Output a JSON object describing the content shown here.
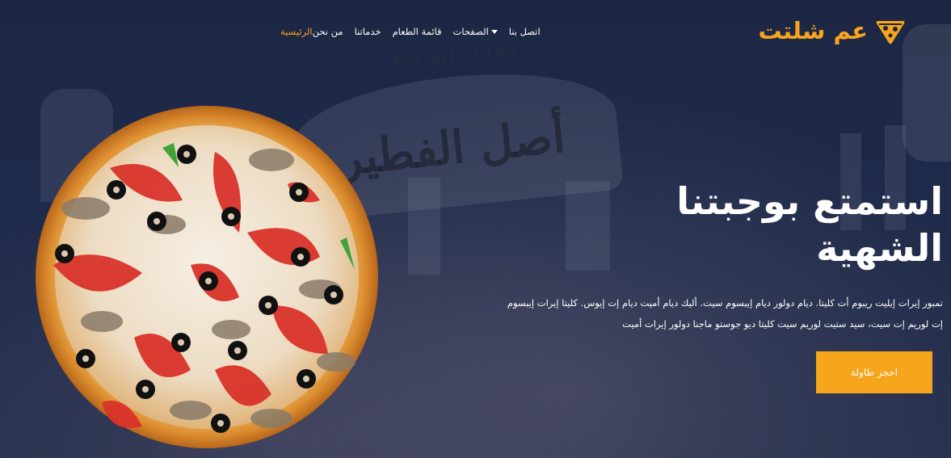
{
  "brand": {
    "name": "عم شلتت",
    "color": "#f7a51c",
    "icon": "pizza-slice-icon"
  },
  "nav": {
    "items": [
      {
        "label": "الرئيسية",
        "active": true
      },
      {
        "label": "من نحن"
      },
      {
        "label": "خدماتنا"
      },
      {
        "label": "قائمة الطعام"
      },
      {
        "label": "الصفحات",
        "dropdown": true
      },
      {
        "label": "اتصل بنا"
      }
    ]
  },
  "hero": {
    "title_line1": "استمتع بوجبتنا",
    "title_line2": "الشهية",
    "description": "تمبور إيرات إيليت ريبوم أت كليتا. ديام دولور ديام إيبسوم سيت. أليك ديام أميت ديام إت إيوس. كليتا إيرات إيبسوم إت لوريم إت سيت، سيد ستيت لوريم سيت كليتا ديو جوستو ماجنا دولور إيرات أميت",
    "cta_label": "احجز طاولة"
  },
  "background_text": {
    "line1": "أصل الفطير",
    "line2": "AM SHALTAT"
  },
  "colors": {
    "accent": "#f7a51c",
    "background": "#1b2540",
    "text": "#ffffff"
  }
}
